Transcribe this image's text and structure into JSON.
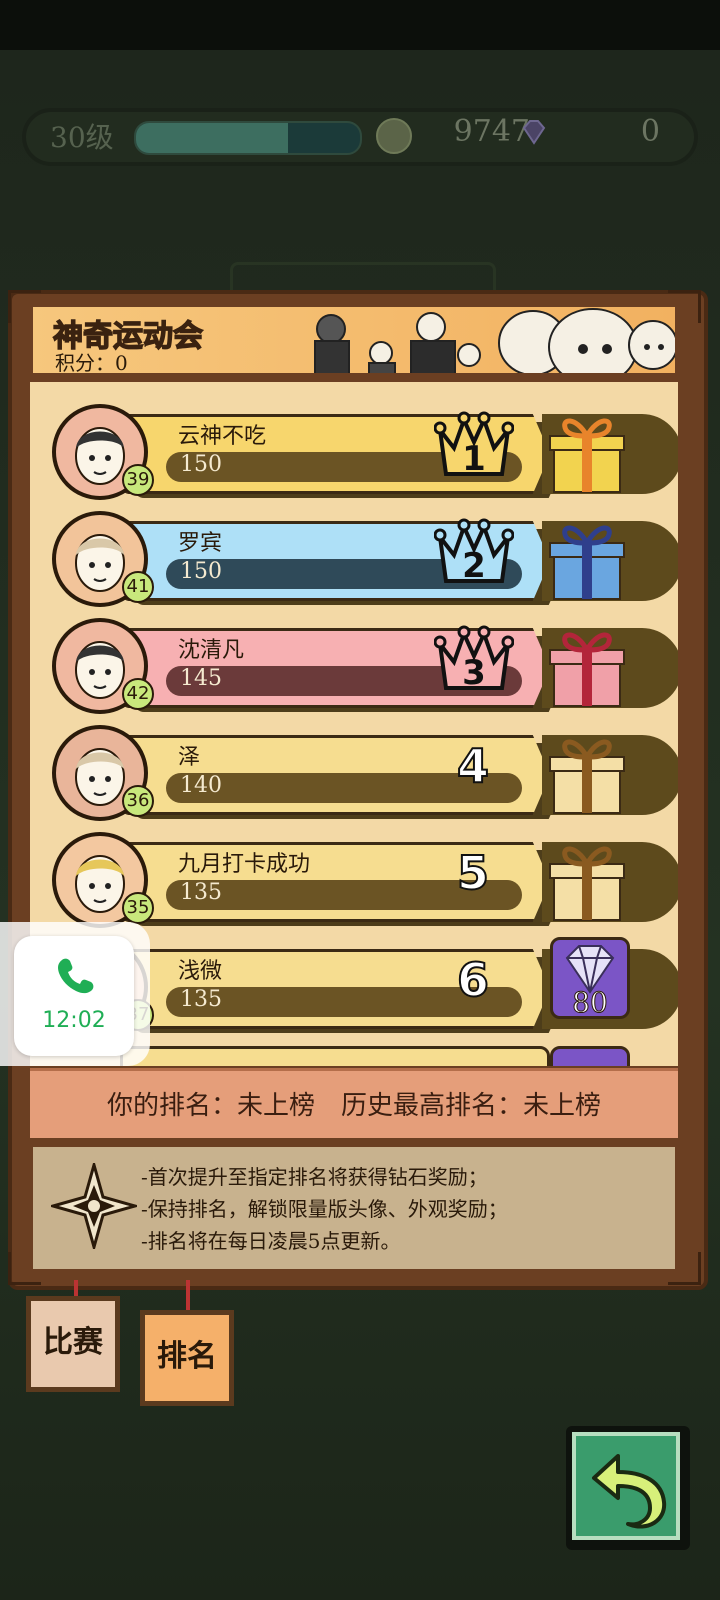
{
  "status": {
    "level": "30级",
    "xp_progress": 0.68,
    "coins": "9747",
    "gems": "0"
  },
  "header": {
    "title": "神奇运动会",
    "score": "积分：0"
  },
  "rankings": [
    {
      "rank": "1",
      "name": "云神不吃",
      "score": "150",
      "level": "39",
      "theme": "gold",
      "reward": "gold-gift"
    },
    {
      "rank": "2",
      "name": "罗宾",
      "score": "150",
      "level": "41",
      "theme": "blue",
      "reward": "blue-gift"
    },
    {
      "rank": "3",
      "name": "沈清凡",
      "score": "145",
      "level": "42",
      "theme": "pink",
      "reward": "red-gift"
    },
    {
      "rank": "4",
      "name": "泽",
      "score": "140",
      "level": "36",
      "theme": "plain",
      "reward": "plain-gift"
    },
    {
      "rank": "5",
      "name": "九月打卡成功",
      "score": "135",
      "level": "35",
      "theme": "plain",
      "reward": "plain-gift"
    },
    {
      "rank": "6",
      "name": "浅微",
      "score": "135",
      "level": "37",
      "theme": "plain",
      "reward": "diamond",
      "reward_amount": "80"
    }
  ],
  "my_rank": {
    "text": "你的排名：未上榜　历史最高排名：未上榜"
  },
  "info_lines": [
    "-首次提升至指定排名将获得钻石奖励；",
    "-保持排名，解锁限量版头像、外观奖励；",
    "-排名将在每日凌晨5点更新。"
  ],
  "tabs": {
    "match": "比赛",
    "ranking": "排名"
  },
  "call_widget": {
    "time": "12:02"
  },
  "colors": {
    "gold": "#f7d66d",
    "blue": "#aee0f7",
    "pink": "#f7b0b2",
    "plain": "#f6dd90",
    "accent_green": "#3a9c6c"
  }
}
